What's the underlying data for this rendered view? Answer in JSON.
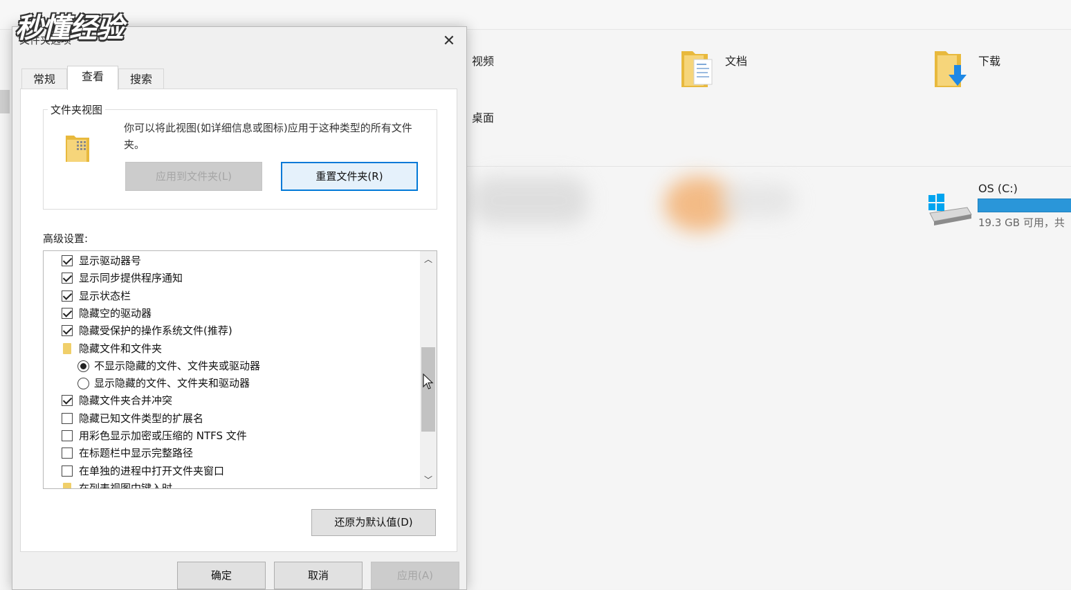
{
  "watermark": "秒懂经验",
  "explorer": {
    "folders": [
      {
        "label": "视频"
      },
      {
        "label": "文档"
      },
      {
        "label": "下载"
      },
      {
        "label": "桌面"
      }
    ],
    "drive": {
      "name": "OS (C:)",
      "sub": "19.3 GB 可用，共"
    }
  },
  "dialog": {
    "title": "文件夹选项",
    "close_glyph": "✕",
    "tabs": [
      {
        "label": "常规",
        "active": false
      },
      {
        "label": "查看",
        "active": true
      },
      {
        "label": "搜索",
        "active": false
      }
    ],
    "folder_views": {
      "legend": "文件夹视图",
      "description": "你可以将此视图(如详细信息或图标)应用于这种类型的所有文件夹。",
      "apply_button": "应用到文件夹(L)",
      "reset_button": "重置文件夹(R)"
    },
    "advanced": {
      "label": "高级设置:",
      "items": [
        {
          "type": "checkbox",
          "checked": true,
          "label": "显示驱动器号"
        },
        {
          "type": "checkbox",
          "checked": true,
          "label": "显示同步提供程序通知"
        },
        {
          "type": "checkbox",
          "checked": true,
          "label": "显示状态栏"
        },
        {
          "type": "checkbox",
          "checked": true,
          "label": "隐藏空的驱动器"
        },
        {
          "type": "checkbox",
          "checked": true,
          "label": "隐藏受保护的操作系统文件(推荐)"
        },
        {
          "type": "folder",
          "checked": false,
          "label": "隐藏文件和文件夹"
        },
        {
          "type": "radio",
          "checked": true,
          "label": "不显示隐藏的文件、文件夹或驱动器"
        },
        {
          "type": "radio",
          "checked": false,
          "label": "显示隐藏的文件、文件夹和驱动器"
        },
        {
          "type": "checkbox",
          "checked": true,
          "label": "隐藏文件夹合并冲突"
        },
        {
          "type": "checkbox",
          "checked": false,
          "label": "隐藏已知文件类型的扩展名"
        },
        {
          "type": "checkbox",
          "checked": false,
          "label": "用彩色显示加密或压缩的 NTFS 文件"
        },
        {
          "type": "checkbox",
          "checked": false,
          "label": "在标题栏中显示完整路径"
        },
        {
          "type": "checkbox",
          "checked": false,
          "label": "在单独的进程中打开文件夹窗口"
        },
        {
          "type": "folder",
          "checked": false,
          "label": "在列表视图中键入时"
        }
      ],
      "scroll_up": "︿",
      "scroll_down": "﹀"
    },
    "restore_button": "还原为默认值(D)",
    "ok_button": "确定",
    "cancel_button": "取消",
    "apply_button": "应用(A)"
  }
}
